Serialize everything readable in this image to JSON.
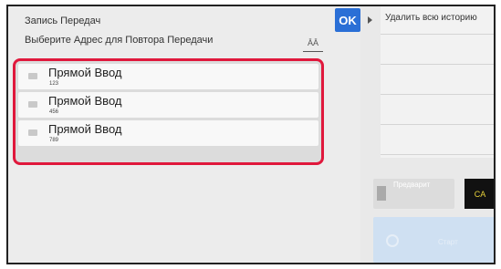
{
  "header": {
    "title": "Запись Передач",
    "subtitle": "Выберите Адрес для Повтора Передачи",
    "ok_label": "OK",
    "sort_label": "ĀĀ"
  },
  "list": {
    "items": [
      {
        "label": "Прямой Ввод",
        "number": "123"
      },
      {
        "label": "Прямой Ввод",
        "number": "456"
      },
      {
        "label": "Прямой Ввод",
        "number": "789"
      }
    ]
  },
  "side": {
    "delete_all_label": "Удалить всю историю",
    "preview_label": "Предварит",
    "ca_label": "CA",
    "start_label": "Старт"
  },
  "colors": {
    "ok_button": "#2a6fd6",
    "highlight_border": "#e0183c",
    "ca_text": "#e8d23a",
    "start_button": "#cfe0f2"
  }
}
